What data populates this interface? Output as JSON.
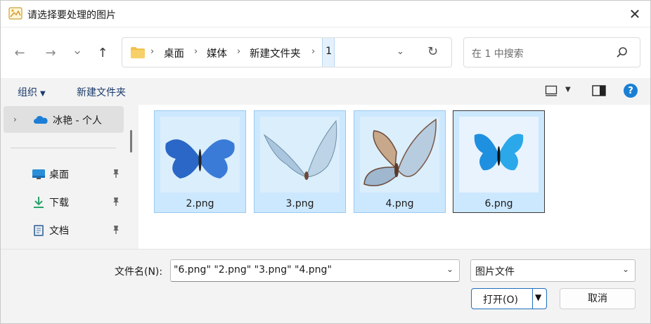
{
  "window": {
    "title": "请选择要处理的图片",
    "close_glyph": "✕"
  },
  "nav": {
    "back_glyph": "←",
    "forward_glyph": "→",
    "recent_glyph": "⌄",
    "up_glyph": "↑"
  },
  "address": {
    "crumbs": [
      "桌面",
      "媒体",
      "新建文件夹"
    ],
    "separator": "›",
    "current": "1",
    "dropdown_glyph": "⌄",
    "refresh_glyph": "↻"
  },
  "search": {
    "placeholder": "在 1 中搜索"
  },
  "commands": {
    "organize": "组织",
    "new_folder": "新建文件夹",
    "caret": "▼",
    "help": "?"
  },
  "sidebar": {
    "cloud_label": "冰艳 - 个人",
    "expand_glyph": "›",
    "items": [
      {
        "label": "桌面",
        "icon": "desktop-icon"
      },
      {
        "label": "下载",
        "icon": "download-icon"
      },
      {
        "label": "文档",
        "icon": "document-icon"
      }
    ]
  },
  "files": [
    {
      "name": "2.png",
      "color": "#2a67c6",
      "selected": true,
      "focused": false
    },
    {
      "name": "3.png",
      "color": "#a9c6de",
      "selected": true,
      "focused": false
    },
    {
      "name": "4.png",
      "color": "#9fb7cf",
      "selected": true,
      "focused": false
    },
    {
      "name": "6.png",
      "color": "#1f8fe0",
      "selected": true,
      "focused": true
    }
  ],
  "bottom": {
    "filename_label": "文件名(N):",
    "filename_value": "\"6.png\" \"2.png\" \"3.png\" \"4.png\"",
    "filetype_value": "图片文件",
    "open_label": "打开(O)",
    "cancel_label": "取消",
    "caret": "⌄",
    "split_caret": "▼"
  },
  "colors": {
    "accent": "#1a7fd4",
    "selection": "#cce8ff",
    "folder": "#f2c04b"
  }
}
